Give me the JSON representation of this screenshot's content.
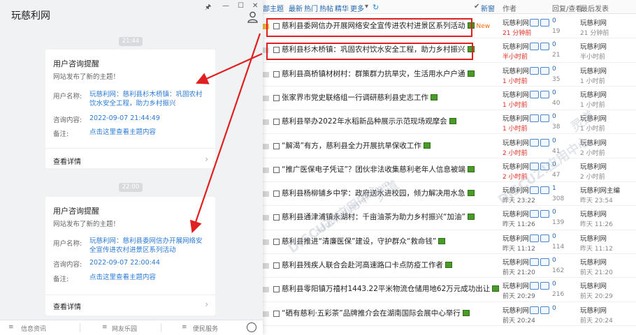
{
  "panel": {
    "title": "玩慈利网",
    "window_buttons": [
      "🖈",
      "—",
      "☐",
      "✕"
    ],
    "bottom_tabs": [
      "信息资讯",
      "网友乐园",
      "便民服务"
    ]
  },
  "notifications": [
    {
      "time": "21:44",
      "heading": "用户咨询提醒",
      "subtitle": "网站发布了新的主题！",
      "name_label": "用户名称:",
      "name_value": "玩慈利网：慈利县杉木桥镇：巩固农村饮水安全工程，助力乡村振兴",
      "time_label": "咨询内容:",
      "time_value": "2022-09-07 21:44:49",
      "note_label": "备注:",
      "note_value": "点击这里查看主题内容",
      "more": "查看详情"
    },
    {
      "time": "22:00",
      "heading": "用户咨询提醒",
      "subtitle": "网站发布了新的主题！",
      "name_label": "用户名称:",
      "name_value": "玩慈利网：慈利县委网信办开展网络安全宣传进农村进景区系列活动",
      "time_label": "咨询内容:",
      "time_value": "2022-09-07 22:00:44",
      "note_label": "备注:",
      "note_value": "点击这里查看主题内容",
      "more": "查看详情"
    }
  ],
  "forum": {
    "filters": [
      "部主题",
      "最新",
      "热门",
      "热帖",
      "精华",
      "更多"
    ],
    "new_window": "新窗",
    "col_author": "作者",
    "col_reply": "回复/查看",
    "col_last": "最后发表",
    "rows": [
      {
        "title": "慈利县委网信办开展网络安全宣传进农村进景区系列活动",
        "new": "New",
        "author": "玩慈利网",
        "atime": "21 分钟前",
        "red": true,
        "replies": "0",
        "views": "19",
        "lastu": "玩慈利网",
        "lastt": "21 分钟前"
      },
      {
        "title": "慈利县杉木桥镇：巩固农村饮水安全工程，助力乡村振兴",
        "new": "",
        "author": "玩慈利网",
        "atime": "半小时前",
        "red": true,
        "replies": "0",
        "views": "21",
        "lastu": "玩慈利网",
        "lastt": "半小时前"
      },
      {
        "title": "慈利县高桥镇材树村：群策群力抗旱灾，生活用水户户通",
        "new": "",
        "author": "玩慈利网",
        "atime": "1 小时前",
        "red": true,
        "replies": "0",
        "views": "35",
        "lastu": "玩慈利网",
        "lastt": "1 小时前"
      },
      {
        "title": "张家界市党史联络组一行调研慈利县史志工作",
        "new": "",
        "author": "玩慈利网",
        "atime": "1 小时前",
        "red": true,
        "replies": "0",
        "views": "40",
        "lastu": "玩慈利网",
        "lastt": "1 小时前"
      },
      {
        "title": "慈利县举办2022年水稻新品种展示示范现场观摩会",
        "new": "",
        "author": "玩慈利网",
        "atime": "1 小时前",
        "red": true,
        "replies": "0",
        "views": "38",
        "lastu": "玩慈利网",
        "lastt": "1 小时前"
      },
      {
        "title": "“解渴”有方，慈利县全力开展抗旱保收工作",
        "new": "",
        "author": "玩慈利网",
        "atime": "2 小时前",
        "red": true,
        "replies": "0",
        "views": "41",
        "lastu": "玩慈利网",
        "lastt": "2 小时前"
      },
      {
        "title": "“推广医保电子凭证”？团伙非法收集慈利老年人信息被端",
        "new": "",
        "author": "玩慈利网",
        "atime": "2 小时前",
        "red": true,
        "replies": "0",
        "views": "47",
        "lastu": "玩慈利网",
        "lastt": "2 小时前"
      },
      {
        "title": "慈利县杨柳铺乡中学：政府送水进校园，倾力解决用水急",
        "new": "",
        "author": "玩慈利网",
        "atime": "昨天 23:22",
        "red": false,
        "replies": "1",
        "views": "308",
        "lastu": "玩慈利网主编",
        "lastt": "昨天 23:54"
      },
      {
        "title": "慈利县通津浦镇永湖村：千亩油茶为助力乡村振兴“加油”",
        "new": "",
        "author": "玩慈利网",
        "atime": "昨天 11:26",
        "red": false,
        "replies": "0",
        "views": "139",
        "lastu": "玩慈利网",
        "lastt": "昨天 11:26"
      },
      {
        "title": "慈利县推进“清廉医保”建设，守护群众“救命钱”",
        "new": "",
        "author": "玩慈利网",
        "atime": "昨天 11:12",
        "red": false,
        "replies": "0",
        "views": "114",
        "lastu": "玩慈利网",
        "lastt": "昨天 11:12"
      },
      {
        "title": "慈利县残疾人联合会赴河高速路口卡点防疫工作者",
        "new": "",
        "author": "玩慈利网",
        "atime": "前天 21:20",
        "red": false,
        "replies": "0",
        "views": "162",
        "lastu": "玩慈利网",
        "lastt": "前天 21:20"
      },
      {
        "title": "慈利县零阳镇万禧村1443.22平米物流仓储用地62万元成功出让",
        "new": "",
        "author": "玩慈利网",
        "atime": "前天 20:29",
        "red": false,
        "replies": "0",
        "views": "216",
        "lastu": "玩慈利网",
        "lastt": "前天 20:29"
      },
      {
        "title": "“硒有慈利·五彩茶”品牌推介会在湖南国际会展中心举行",
        "new": "",
        "author": "玩慈利网",
        "atime": "前天 20:24",
        "red": false,
        "replies": "0",
        "views": "",
        "lastu": "玩慈利网",
        "lastt": "前天 20:24"
      }
    ]
  },
  "watermarks": [
    "DISCUZ!应用中心",
    "addon.dismall.com",
    "灵道"
  ],
  "colors": {
    "link": "#2a7ad6",
    "red": "#e02020",
    "new": "#f26c0d"
  }
}
